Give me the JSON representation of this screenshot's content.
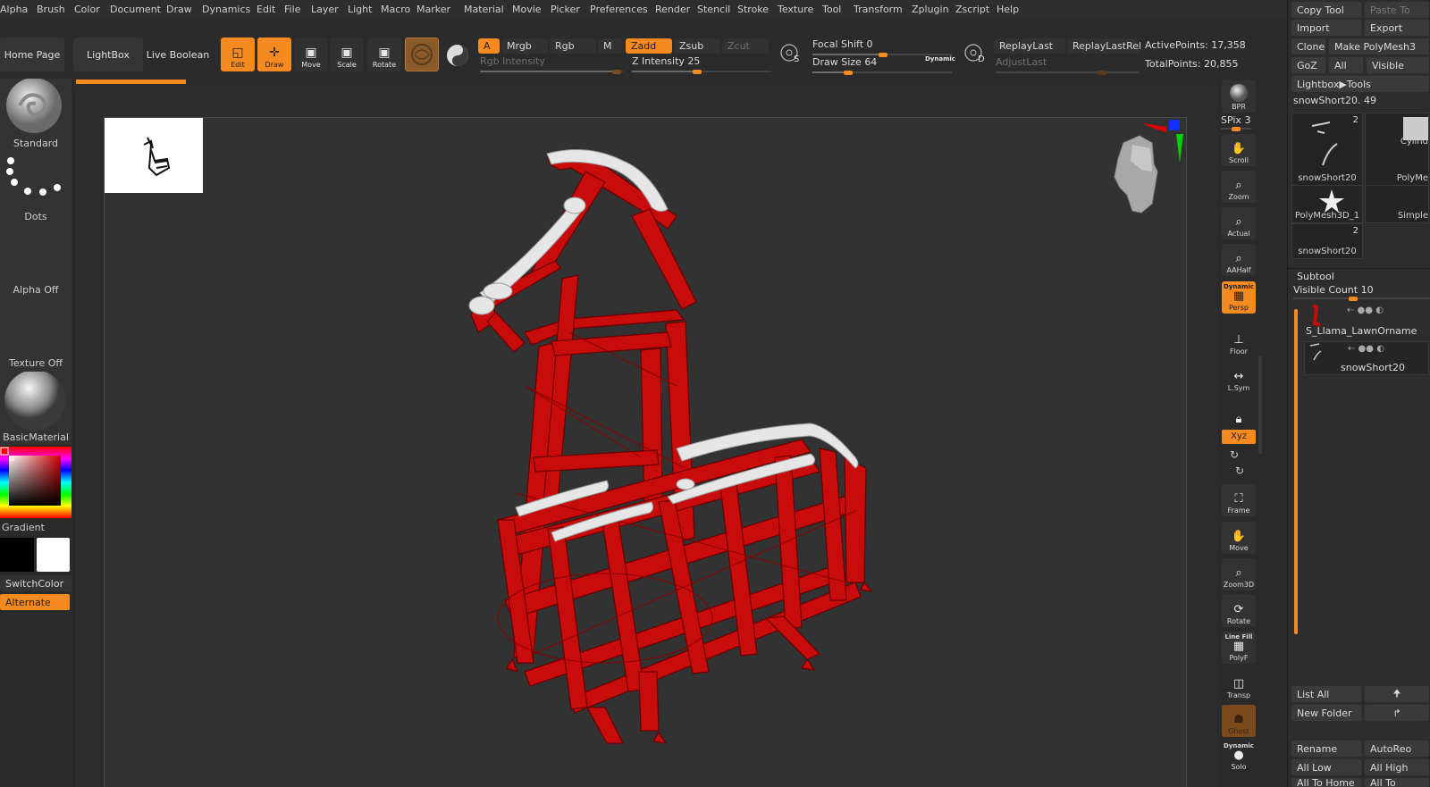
{
  "menu": [
    "Alpha",
    "Brush",
    "Color",
    "Document",
    "Draw",
    "Dynamics",
    "Edit",
    "File",
    "Layer",
    "Light",
    "Macro",
    "Marker",
    "Material",
    "Movie",
    "Picker",
    "Preferences",
    "Render",
    "Stencil",
    "Stroke",
    "Texture",
    "Tool",
    "Transform",
    "Zplugin",
    "Zscript",
    "Help"
  ],
  "topbar": {
    "home_page": "Home Page",
    "lightbox": "LightBox",
    "live_boolean": "Live Boolean",
    "tools": [
      {
        "label": "Edit",
        "icon": "edit-icon",
        "active": true
      },
      {
        "label": "Draw",
        "icon": "draw-icon",
        "active": true
      },
      {
        "label": "Move",
        "icon": "move-icon",
        "active": false
      },
      {
        "label": "Scale",
        "icon": "scale-icon",
        "active": false
      },
      {
        "label": "Rotate",
        "icon": "rotate-icon",
        "active": false
      }
    ],
    "a_label": "A",
    "mrgb": "Mrgb",
    "rgb": "Rgb",
    "m": "M",
    "rgb_intensity": "Rgb Intensity",
    "zadd": "Zadd",
    "zsub": "Zsub",
    "zcut": "Zcut",
    "z_intensity_label": "Z Intensity",
    "z_intensity_value": "25",
    "focal_shift_label": "Focal Shift",
    "focal_shift_value": "0",
    "draw_size_label": "Draw Size",
    "draw_size_value": "64",
    "dynamic": "Dynamic",
    "s_label": "S",
    "d_label": "D",
    "replay_last": "ReplayLast",
    "replay_last_rel": "ReplayLastRel",
    "adjust_last": "AdjustLast",
    "active_points_label": "ActivePoints:",
    "active_points": "17,358",
    "total_points_label": "TotalPoints:",
    "total_points": "20,855"
  },
  "left_shelf": {
    "brush": "Standard",
    "stroke": "Dots",
    "alpha": "Alpha Off",
    "texture": "Texture Off",
    "material": "BasicMaterial",
    "gradient": "Gradient",
    "switch_color": "SwitchColor",
    "alternate": "Alternate",
    "main_color": "#ff0000"
  },
  "right_shelf": {
    "bpr": "BPR",
    "spix_label": "SPix",
    "spix_value": "3",
    "buttons": [
      "Scroll",
      "Zoom",
      "Actual",
      "AAHalf"
    ],
    "persp_top": "Dynamic",
    "persp": "Persp",
    "floor": "Floor",
    "lsym": "L.Sym",
    "xyz": "Xyz",
    "frame": "Frame",
    "move": "Move",
    "zoom3d": "Zoom3D",
    "rotate": "Rotate",
    "linefill": "Line Fill",
    "polyf": "PolyF",
    "transp": "Transp",
    "ghost": "Ghost",
    "solo_top": "Dynamic",
    "solo": "Solo"
  },
  "right_panel": {
    "copy_tool": "Copy Tool",
    "paste_tool": "Paste To",
    "import": "Import",
    "export": "Export",
    "clone": "Clone",
    "make_polymesh": "Make PolyMesh3",
    "goz": "GoZ",
    "all": "All",
    "visible": "Visible",
    "lightbox_tools": "Lightbox▶Tools",
    "current_tool": "snowShort20. 49",
    "thumbs": [
      {
        "label": "snowShort20",
        "count": "2"
      },
      {
        "label": "Cylind",
        "count": ""
      },
      {
        "label": "PolyMe",
        "count": ""
      },
      {
        "label": "PolyMesh3D_1",
        "count": ""
      },
      {
        "label": "Simple",
        "count": ""
      },
      {
        "label": "snowShort20",
        "count": "2"
      }
    ],
    "subtool": "Subtool",
    "visible_count_label": "Visible Count",
    "visible_count": "10",
    "subtool_items": [
      "S_Llama_LawnOrname",
      "snowShort20"
    ],
    "list_all": "List All",
    "new_folder": "New Folder",
    "rename": "Rename",
    "auto_reorder": "AutoReo",
    "all_low": "All Low",
    "all_high": "All High",
    "all_to_home": "All To Home",
    "all_to": "All To"
  },
  "colors": {
    "accent": "#f48a20",
    "model_red": "#c80b0b",
    "snow": "#e6e6e6"
  }
}
